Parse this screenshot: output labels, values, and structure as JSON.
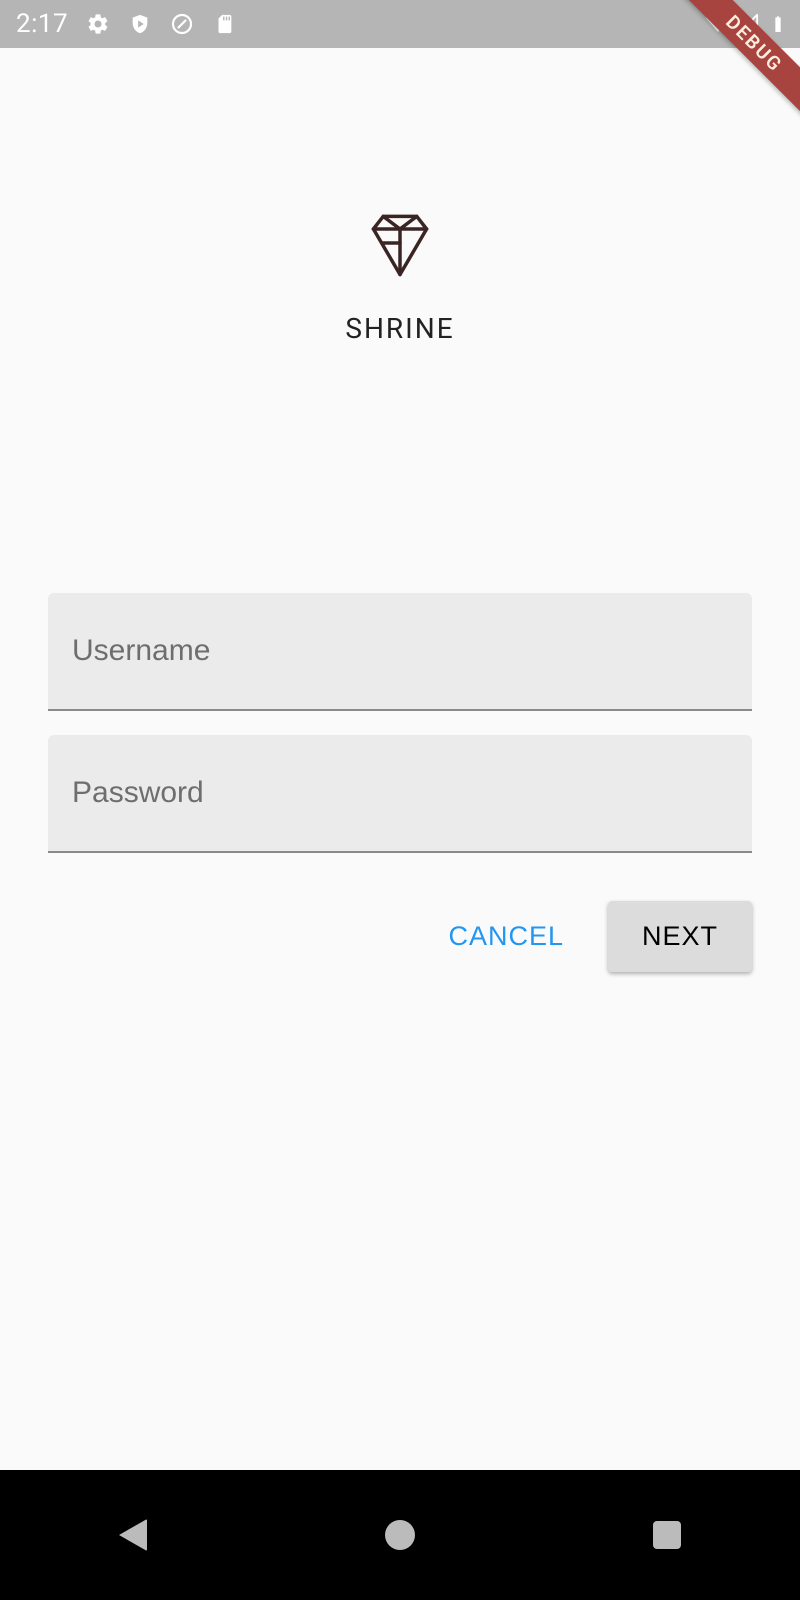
{
  "statusbar": {
    "time": "2:17"
  },
  "debug_ribbon": "DEBUG",
  "app": {
    "title": "SHRINE"
  },
  "form": {
    "username": {
      "placeholder": "Username",
      "value": ""
    },
    "password": {
      "placeholder": "Password",
      "value": ""
    }
  },
  "buttons": {
    "cancel": "CANCEL",
    "next": "NEXT"
  }
}
